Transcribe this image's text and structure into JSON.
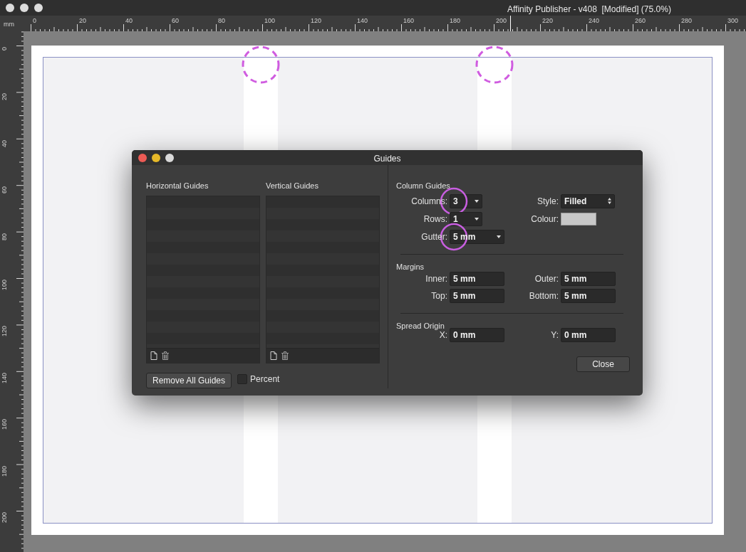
{
  "window": {
    "title": "Affinity Publisher - v408  [Modified] (75.0%)"
  },
  "ruler": {
    "unit": "mm",
    "horizontal_labels": [
      "0",
      "20",
      "40",
      "60",
      "80",
      "100",
      "120",
      "140",
      "160",
      "180",
      "200",
      "220",
      "240",
      "260",
      "280",
      "300"
    ],
    "vertical_labels": [
      "0",
      "20",
      "40",
      "60",
      "80",
      "100",
      "120",
      "140",
      "160",
      "180",
      "200"
    ]
  },
  "dialog": {
    "title": "Guides",
    "lists": [
      {
        "title": "Horizontal Guides"
      },
      {
        "title": "Vertical Guides"
      }
    ],
    "remove_button": "Remove All Guides",
    "percent": {
      "label": "Percent",
      "checked": false
    },
    "column_guides": {
      "title": "Column Guides",
      "fields": [
        {
          "label": "Columns:",
          "value": "3",
          "highlighted": true
        },
        {
          "label": "Rows:",
          "value": "1",
          "highlighted": false
        },
        {
          "label": "Gutter:",
          "value": "5 mm",
          "highlighted": true
        }
      ],
      "style": {
        "label": "Style:",
        "value": "Filled"
      },
      "colour": {
        "label": "Colour:",
        "color": "#c8c8c8"
      }
    },
    "margins": {
      "title": "Margins",
      "fields": [
        {
          "label": "Inner:",
          "value": "5 mm"
        },
        {
          "label": "Outer:",
          "value": "5 mm"
        },
        {
          "label": "Top:",
          "value": "5 mm"
        },
        {
          "label": "Bottom:",
          "value": "5 mm"
        }
      ]
    },
    "spread_origin": {
      "title": "Spread Origin",
      "fields": [
        {
          "label": "X:",
          "value": "0 mm"
        },
        {
          "label": "Y:",
          "value": "0 mm"
        }
      ]
    },
    "close_button": "Close"
  }
}
